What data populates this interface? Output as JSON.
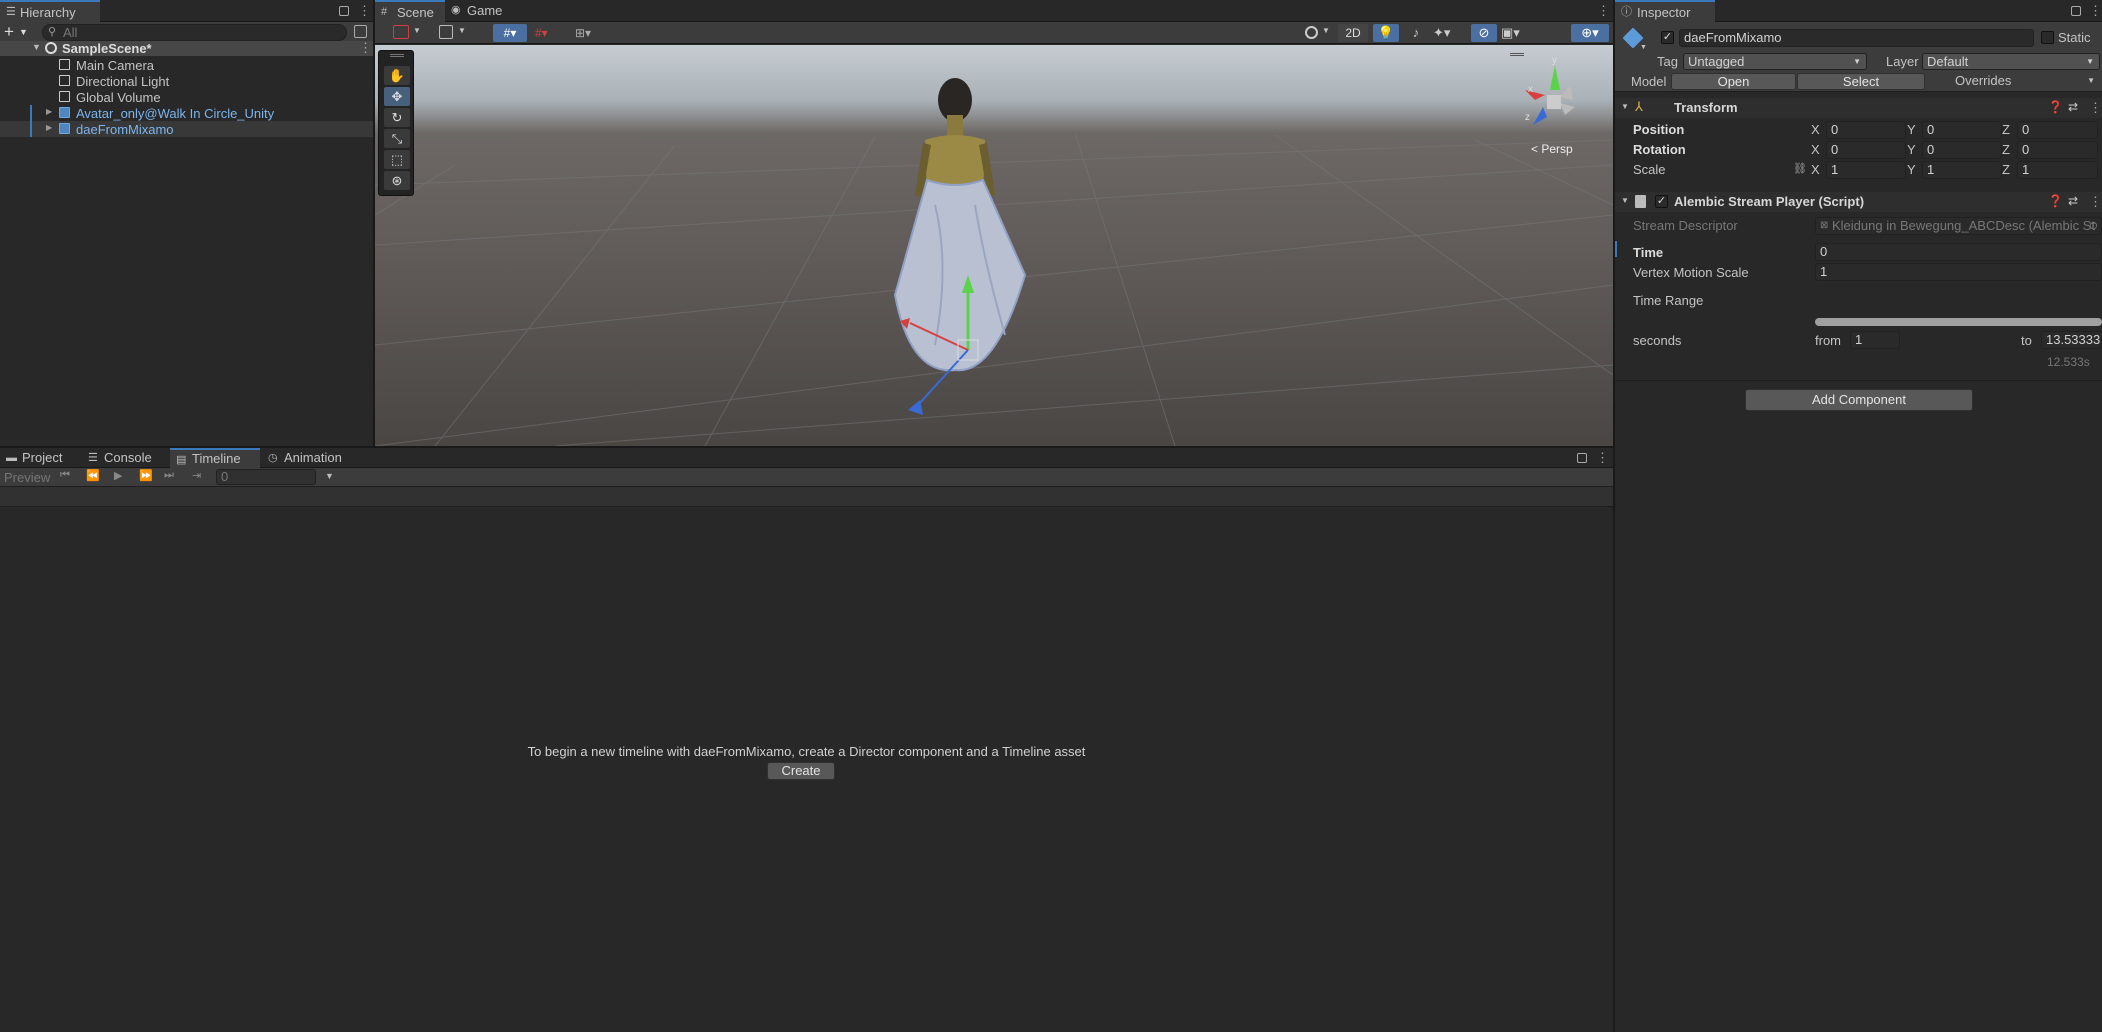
{
  "hierarchy": {
    "title": "Hierarchy",
    "search_placeholder": "All",
    "scene": "SampleScene*",
    "items": [
      {
        "label": "Main Camera",
        "type": "object"
      },
      {
        "label": "Directional Light",
        "type": "object"
      },
      {
        "label": "Global Volume",
        "type": "object"
      },
      {
        "label": "Avatar_only@Walk In Circle_Unity",
        "type": "prefab"
      },
      {
        "label": "daeFromMixamo",
        "type": "prefab"
      }
    ]
  },
  "scene_view": {
    "tabs": [
      "Scene",
      "Game"
    ],
    "mode_2d": "2D",
    "persp_label": "< Persp",
    "gizmo_axes": {
      "x": "x",
      "y": "y",
      "z": "z"
    }
  },
  "bottom": {
    "tabs": [
      "Project",
      "Console",
      "Timeline",
      "Animation"
    ],
    "preview_label": "Preview",
    "frame_value": "0",
    "message": "To begin a new timeline with daeFromMixamo, create a Director component and a Timeline asset",
    "create_label": "Create"
  },
  "inspector": {
    "title": "Inspector",
    "object_name": "daeFromMixamo",
    "static_label": "Static",
    "tag_label": "Tag",
    "tag_value": "Untagged",
    "layer_label": "Layer",
    "layer_value": "Default",
    "model_label": "Model",
    "open_label": "Open",
    "select_label": "Select",
    "overrides_label": "Overrides",
    "transform": {
      "title": "Transform",
      "rows": [
        {
          "label": "Position",
          "x": "0",
          "y": "0",
          "z": "0"
        },
        {
          "label": "Rotation",
          "x": "0",
          "y": "0",
          "z": "0"
        },
        {
          "label": "Scale",
          "x": "1",
          "y": "1",
          "z": "1"
        }
      ],
      "axis": {
        "x": "X",
        "y": "Y",
        "z": "Z"
      }
    },
    "alembic": {
      "title": "Alembic Stream Player (Script)",
      "stream_label": "Stream Descriptor",
      "stream_value": "Kleidung in Bewegung_ABCDesc (Alembic St",
      "time_label": "Time",
      "time_value": "0",
      "vms_label": "Vertex Motion Scale",
      "vms_value": "1",
      "range_label": "Time Range",
      "seconds_label": "seconds",
      "from_label": "from",
      "from_value": "1",
      "to_label": "to",
      "to_value": "13.53333",
      "duration": "12.533s"
    },
    "add_component": "Add Component"
  }
}
